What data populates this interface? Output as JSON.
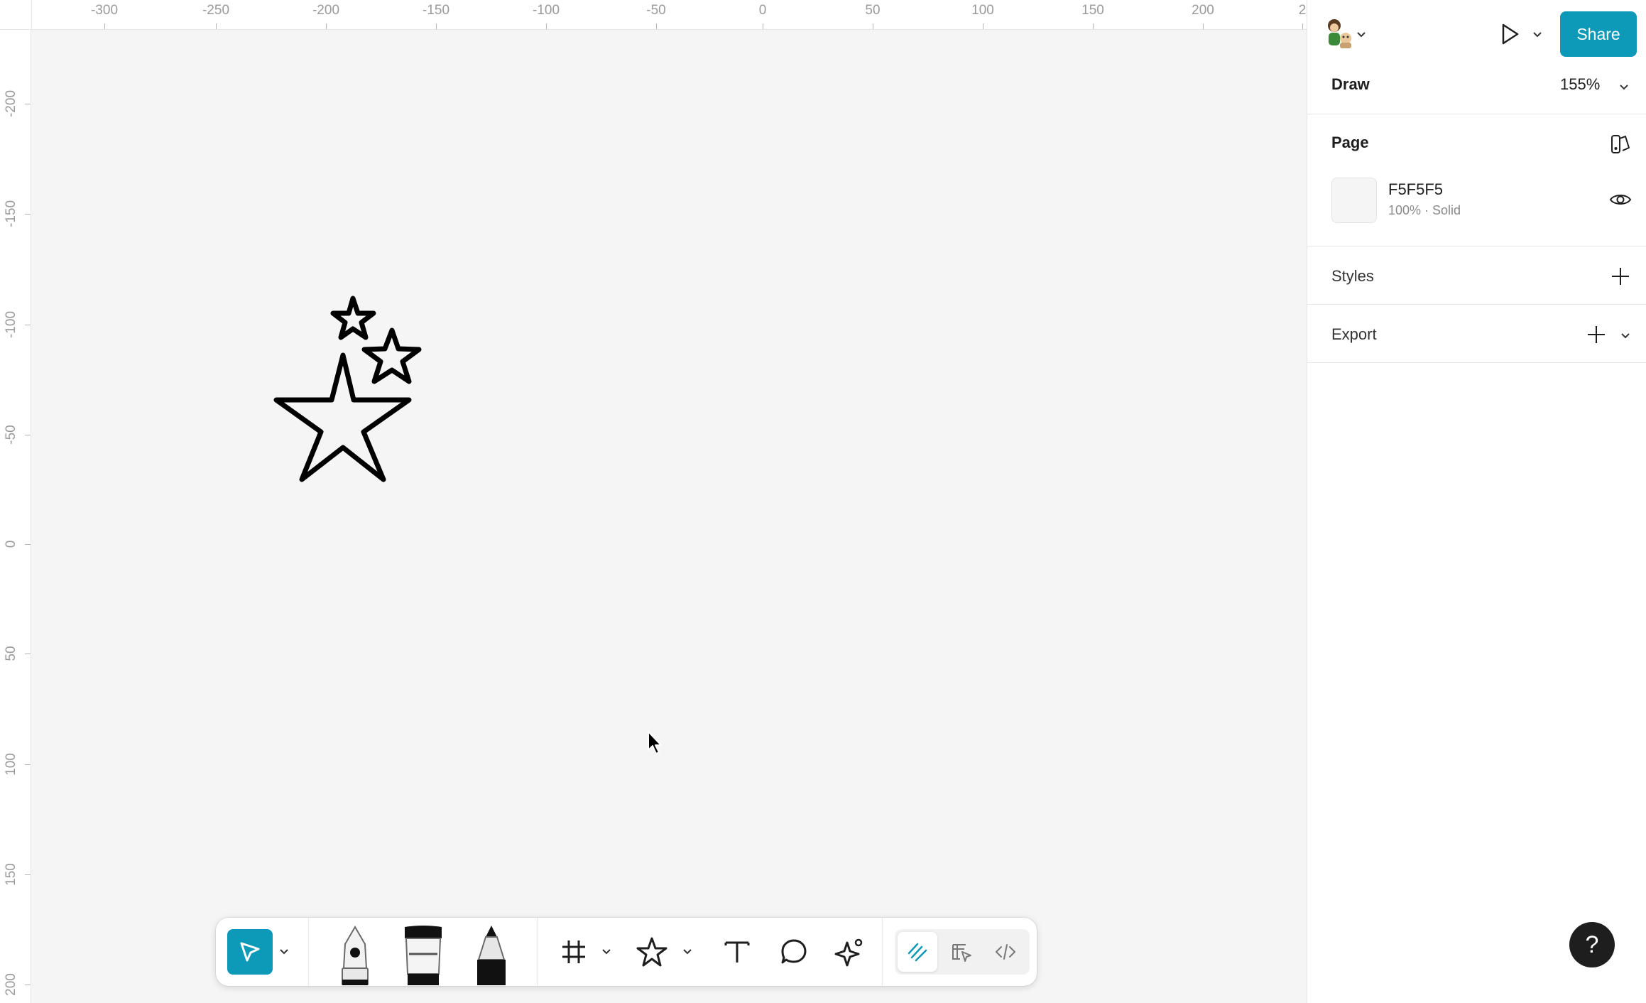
{
  "rulers": {
    "horizontal": [
      "-300",
      "-250",
      "-200",
      "-150",
      "-100",
      "-50",
      "0",
      "50",
      "100",
      "150",
      "200",
      "2"
    ],
    "vertical": [
      "-200",
      "-150",
      "-100",
      "-50",
      "0",
      "50",
      "100",
      "150",
      "200"
    ]
  },
  "toolbar": {
    "tools": [
      "move",
      "pen",
      "marker",
      "pencil",
      "frame",
      "shape",
      "text",
      "comment",
      "actions"
    ],
    "modes": [
      "draw",
      "design",
      "dev-mode"
    ],
    "active_tool": "move",
    "accent": "#0d99b8"
  },
  "header": {
    "share_label": "Share"
  },
  "panel": {
    "mode_label": "Draw",
    "zoom": "155%",
    "page": {
      "title": "Page",
      "fill_hex": "F5F5F5",
      "fill_meta": "100% · Solid",
      "fill_color": "#F5F5F5"
    },
    "styles_title": "Styles",
    "export_title": "Export"
  },
  "help_label": "?"
}
